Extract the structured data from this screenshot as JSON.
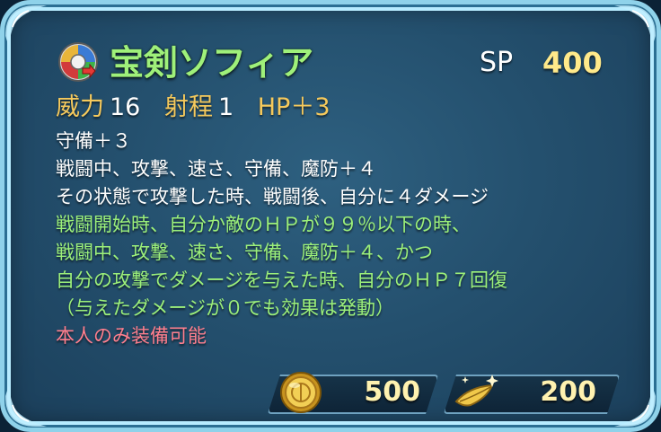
{
  "skill": {
    "name": "宝剣ソフィア",
    "icon": "sword-skill-icon",
    "sp_label": "SP",
    "sp_value": "400"
  },
  "stats": {
    "might_label": "威力",
    "might_value": "16",
    "range_label": "射程",
    "range_value": "1",
    "hp_bonus": "HP＋3"
  },
  "description": {
    "lines_white": [
      "守備＋３",
      "戦闘中、攻撃、速さ、守備、魔防＋４",
      "その状態で攻撃した時、戦闘後、自分に４ダメージ"
    ],
    "lines_green": [
      "戦闘開始時、自分か敵のＨＰが９９％以下の時、",
      "戦闘中、攻撃、速さ、守備、魔防＋４、かつ",
      "自分の攻撃でダメージを与えた時、自分のＨＰ７回復",
      "（与えたダメージが０でも効果は発動）"
    ],
    "restriction": "本人のみ装備可能"
  },
  "costs": {
    "coin_icon": "gold-coin-icon",
    "coin_value": "500",
    "feather_icon": "feather-icon",
    "feather_value": "200"
  },
  "colors": {
    "title": "#9ff07a",
    "effect_green": "#9cf07a",
    "restriction_pink": "#ff7f8e",
    "stat_label_gold": "#f5c95c"
  }
}
